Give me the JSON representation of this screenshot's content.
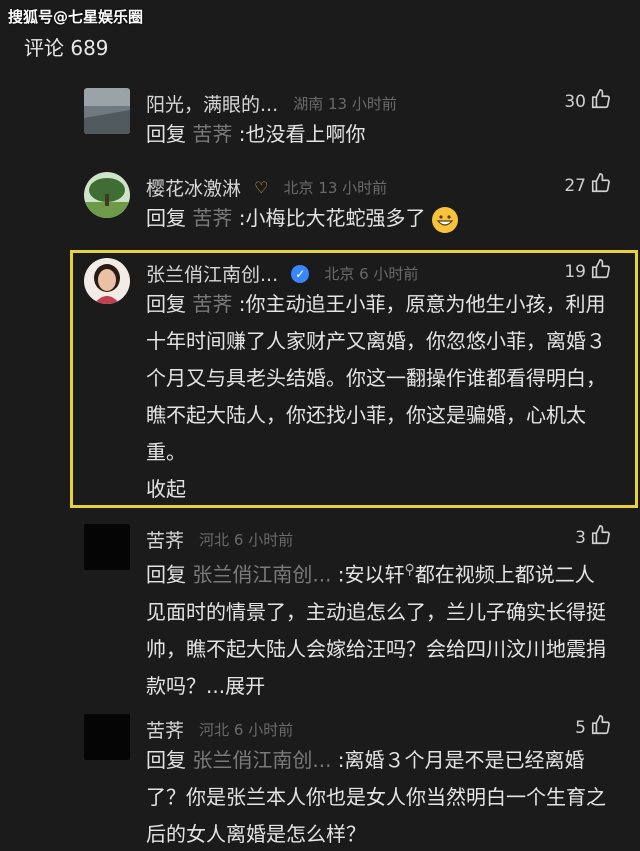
{
  "watermark": "搜狐号@七星娱乐圈",
  "header": {
    "title": "评论 689"
  },
  "comments": [
    {
      "username": "阳光，满眼的...",
      "meta": "湖南 13 小时前",
      "likes": "30",
      "reply_prefix": "回复",
      "reply_target": "苦荠",
      "text": ":也没看上啊你"
    },
    {
      "username": "樱花冰激淋",
      "meta": "北京 13 小时前",
      "likes": "27",
      "reply_prefix": "回复",
      "reply_target": "苦荠",
      "text": ":小梅比大花蛇强多了"
    },
    {
      "username": "张兰俏江南创...",
      "meta": "北京 6 小时前",
      "likes": "19",
      "reply_prefix": "回复",
      "reply_target": "苦荠",
      "text": ":你主动追王小菲，原意为他生小孩，利用十年时间赚了人家财产又离婚，你忽悠小菲，离婚３个月又与具老头结婚。你这一翻操作谁都看得明白，瞧不起大陆人，你还找小菲，你这是骗婚，心机太重。",
      "collapse_label": "收起"
    },
    {
      "username": "苦荠",
      "meta": "河北 6 小时前",
      "likes": "3",
      "reply_prefix": "回复",
      "reply_target": "张兰俏江南创...",
      "text_a": ":安以轩",
      "text_b": "都在视频上都说二人见面时的情景了，主动追怎么了，兰儿子确实长得挺帅，瞧不起大陆人会嫁给汪吗？会给四川汶川地震捐款吗？...",
      "expand_label": "展开"
    },
    {
      "username": "苦荠",
      "meta": "河北 6 小时前",
      "likes": "5",
      "reply_prefix": "回复",
      "reply_target": "张兰俏江南创...",
      "text": ":离婚３个月是不是已经离婚了？你是张兰本人你也是女人你当然明白一个生育之后的女人离婚是怎么样？"
    }
  ],
  "colors": {
    "background": "#1b1b1b",
    "highlight": "#e6d23a",
    "verified": "#3a86ff",
    "vip": "#d9a441"
  }
}
